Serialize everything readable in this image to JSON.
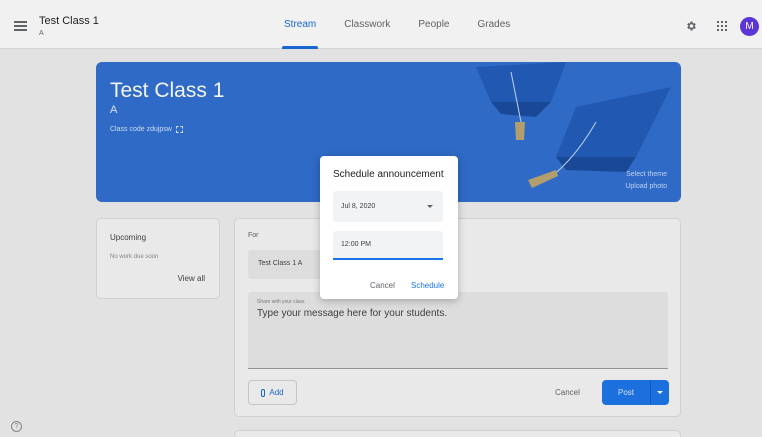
{
  "header": {
    "class_title": "Test Class 1",
    "class_section": "A",
    "tabs": [
      {
        "label": "Stream",
        "active": true
      },
      {
        "label": "Classwork",
        "active": false
      },
      {
        "label": "People",
        "active": false
      },
      {
        "label": "Grades",
        "active": false
      }
    ],
    "avatar_initial": "M"
  },
  "banner": {
    "title": "Test Class 1",
    "section": "A",
    "class_code": "Class code zdujpsw",
    "select_theme": "Select theme",
    "upload_photo": "Upload photo"
  },
  "upcoming": {
    "title": "Upcoming",
    "empty_text": "No work due soon",
    "view_all": "View all"
  },
  "composer": {
    "for_label": "For",
    "for_value": "Test Class 1 A",
    "message_label": "Share with your class",
    "message_text": "Type your message here for your students.",
    "add_label": "Add",
    "cancel_label": "Cancel",
    "post_label": "Post"
  },
  "dialog": {
    "title": "Schedule announcement",
    "date_value": "Jul 8, 2020",
    "time_value": "12:00 PM",
    "cancel_label": "Cancel",
    "schedule_label": "Schedule"
  },
  "colors": {
    "accent": "#1a73e8",
    "banner": "#2d6dcf",
    "avatar": "#5c35d6"
  },
  "icons": [
    "menu-icon",
    "gear-icon",
    "apps-icon",
    "expand-icon",
    "paperclip-icon",
    "help-icon",
    "dropdown-caret-icon"
  ]
}
